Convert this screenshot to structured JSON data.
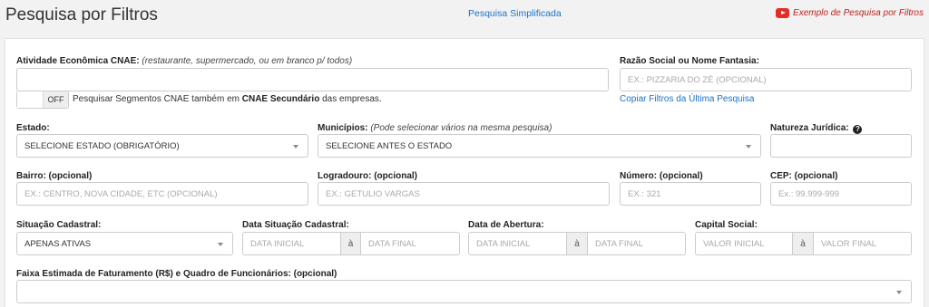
{
  "header": {
    "title": "Pesquisa por Filtros",
    "simple_link": "Pesquisa Simplificada",
    "example_link": "Exemplo de Pesquisa por Filtros",
    "example_icon": "youtube-icon"
  },
  "cnae": {
    "label": "Atividade Econômica CNAE:",
    "hint": "(restaurante, supermercado, ou em branco p/ todos)",
    "value": ""
  },
  "razao": {
    "label": "Razão Social ou Nome Fantasia:",
    "placeholder": "EX.: PIZZARIA DO ZÉ (OPCIONAL)"
  },
  "toggle": {
    "state": "OFF",
    "text_before": "Pesquisar Segmentos CNAE também em",
    "text_bold": "CNAE Secundário",
    "text_after": "das empresas."
  },
  "copy_link": "Copiar Filtros da Última Pesquisa",
  "estado": {
    "label": "Estado:",
    "value": "SELECIONE ESTADO (OBRIGATÓRIO)"
  },
  "municipios": {
    "label": "Municípios:",
    "hint": "(Pode selecionar vários na mesma pesquisa)",
    "value": "SELECIONE ANTES O ESTADO"
  },
  "natureza": {
    "label": "Natureza Jurídica:",
    "help_icon": "question-circle-icon",
    "help_glyph": "?"
  },
  "bairro": {
    "label": "Bairro: (opcional)",
    "placeholder": "EX.: CENTRO, NOVA CIDADE, ETC (OPCIONAL)"
  },
  "logradouro": {
    "label": "Logradouro: (opcional)",
    "placeholder": "EX.: GETULIO VARGAS"
  },
  "numero": {
    "label": "Número: (opcional)",
    "placeholder": "EX.: 321"
  },
  "cep": {
    "label": "CEP: (opcional)",
    "placeholder": "Ex.: 99.999-999"
  },
  "situacao": {
    "label": "Situação Cadastral:",
    "value": "APENAS ATIVAS"
  },
  "data_situacao": {
    "label": "Data Situação Cadastral:",
    "from": "DATA INICIAL",
    "sep": "à",
    "to": "DATA FINAL"
  },
  "data_abertura": {
    "label": "Data de Abertura:",
    "from": "DATA INICIAL",
    "sep": "à",
    "to": "DATA FINAL"
  },
  "capital": {
    "label": "Capital Social:",
    "from": "VALOR INICIAL",
    "sep": "à",
    "to": "VALOR FINAL"
  },
  "faturamento": {
    "label": "Faixa Estimada de Faturamento (R$) e Quadro de Funcionários: (opcional)",
    "value": ""
  }
}
